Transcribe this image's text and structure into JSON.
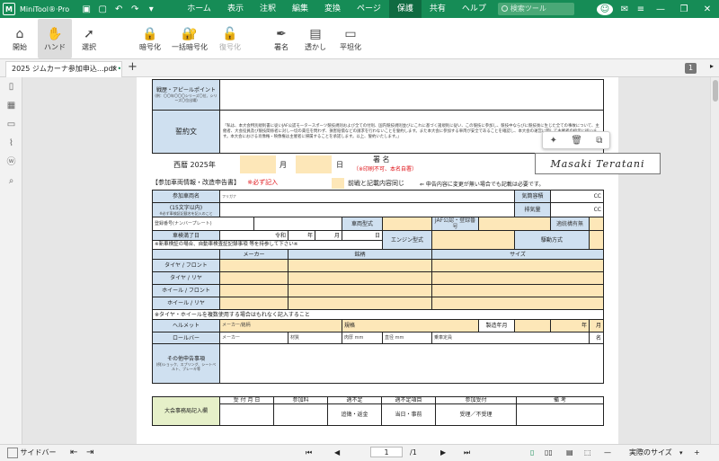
{
  "app": {
    "logo": "M",
    "name": "MiniTool®·Pro",
    "quick": [
      "save-icon",
      "document-icon",
      "undo-icon",
      "redo-icon",
      "dropdown-icon"
    ]
  },
  "menu": [
    "ホーム",
    "表示",
    "注釈",
    "編集",
    "変換",
    "ページ",
    "保護",
    "共有",
    "ヘルプ"
  ],
  "menu_active": "保護",
  "search_placeholder": "検索ツール",
  "ribbon": [
    {
      "label": "開始",
      "icon": "home-icon",
      "glyph": "⌂"
    },
    {
      "label": "ハンド",
      "icon": "hand-icon",
      "glyph": "✋"
    },
    {
      "label": "選択",
      "icon": "cursor-icon",
      "glyph": "➚"
    },
    {
      "label": "暗号化",
      "icon": "lock-icon",
      "glyph": "🔒"
    },
    {
      "label": "一括暗号化",
      "icon": "batch-lock-icon",
      "glyph": "🔐"
    },
    {
      "label": "復号化",
      "icon": "unlock-icon",
      "glyph": "🔓"
    },
    {
      "label": "署名",
      "icon": "signature-icon",
      "glyph": "✒"
    },
    {
      "label": "透かし",
      "icon": "watermark-icon",
      "glyph": "▤"
    },
    {
      "label": "平坦化",
      "icon": "flatten-icon",
      "glyph": "▭"
    }
  ],
  "tab": {
    "title": "2025 ジムカーナ参加申込...pdf",
    "modified": "•",
    "close": "×"
  },
  "page_badge": "1",
  "form": {
    "career_label": "戦歴・アピールポイント",
    "career_note": "(例：〇〇年〇〇〇シリーズ〇位、シリーズ〇位出場)",
    "oath_label": "誓約文",
    "oath_text": "「私は、本大会特別規則書に従いJAF公認モータースポーツ競技規則および全ての付則、国内競技規則並びにこれに基づく諸規則に従い、この競技に参加し、競技中ならびに競技後に生じた全ての事故について、主催者、大会役員及び競技関係者に対し一切の責任を問わず、損害賠償などの請求を行わないことを誓約します。また本大会に参加する車両が安全であることを確認し、本大会の運営に関して主催者の指示に従います。本大会における肖像権・映像権は主催者に帰属することを承諾します。以上、誓約いたします。」",
    "era": "西暦 2025年",
    "month": "月",
    "day": "日",
    "sign_label": "署 名",
    "sign_note": "（※印刷不可、本名自署）",
    "signature": "Masaki Teratani",
    "section_title": "【参加車両情報・改造申告書】",
    "required": "※必ず記入",
    "same_as_prev": "前戦と記載内容同じ",
    "same_note": "⇐ 申告内容に変更が無い場合でも記載は必要です。",
    "car_name": "参加車両名",
    "car_name_note": "(15文字以内)",
    "car_name_sub": "※必ず車検証記載名を記入のこと",
    "furigana": "フリガナ",
    "displacement": "気筒容積",
    "exhaust": "排気量",
    "cc": "CC",
    "plate": "登録番号(ナンバープレート)",
    "model": "車両型式",
    "jaf": "JAF公認・登録番号",
    "license": "適統構有無",
    "inspection": "車検満了日",
    "reiwa": "令和",
    "year": "年",
    "engine": "エンジン型式",
    "drive": "駆動方式",
    "new_car_note": "※新車検証の場合、自動車検査証記録事項 等を持参して下さい※",
    "maker": "メーカー",
    "brand": "銘柄",
    "size": "サイズ",
    "tire_front": "タイヤ / フロント",
    "tire_rear": "タイヤ / リヤ",
    "wheel_front": "ホイール / フロント",
    "wheel_rear": "ホイール / リヤ",
    "multi_note": "※タイヤ・ホイールを複数使用する場合はもれなく記入すること",
    "helmet": "ヘルメット",
    "maker_brand": "メーカー/銘柄",
    "standard": "規格",
    "manufacture": "製造年月",
    "rollbar": "ロールバー",
    "rb_maker": "メーカー",
    "material": "材質",
    "thickness": "肉厚",
    "mm": "mm",
    "diameter": "直径",
    "capacity": "乗車定員",
    "persons": "名",
    "other_label": "その他申告事項",
    "other_note": "(例)ショック、スプリング、シートベルト、ブレーキ等",
    "office_label": "大会事務局記入欄",
    "received": "受 付 月 日",
    "fee": "参加料",
    "ok_ng": "適不定",
    "ok_ng2": "適不定項目",
    "reception": "参加受付",
    "remarks": "備 考",
    "return": "追徴・返金",
    "sameday": "当日・事前",
    "accept": "受理／不受理"
  },
  "status": {
    "sidebar": "サイドバー",
    "page": "1",
    "total": "/1",
    "zoom": "実際のサイズ"
  }
}
